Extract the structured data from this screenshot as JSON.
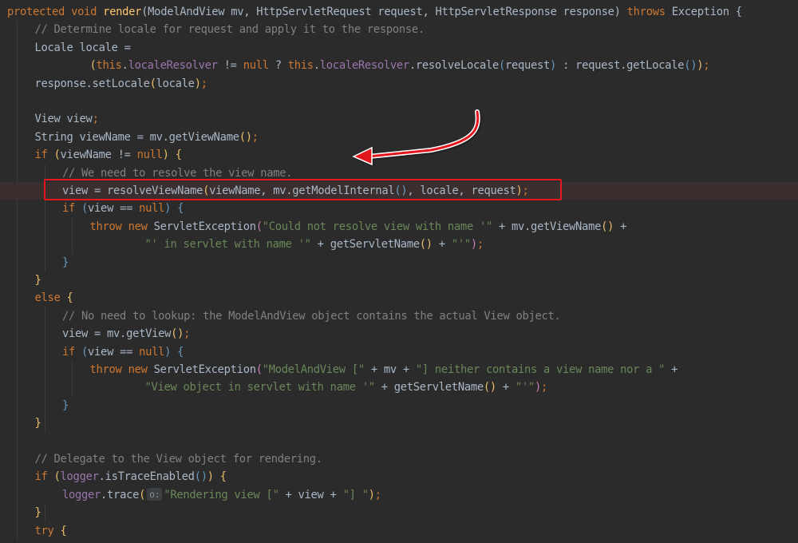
{
  "editor": {
    "language": "java",
    "colors": {
      "background": "#2b2b2b",
      "keyword": "#cc7832",
      "method": "#ffc66d",
      "string": "#6a8759",
      "comment": "#808080",
      "field": "#9876aa",
      "text": "#a9b7c6",
      "annotation_box": "#e3191f",
      "annotation_arrow": "#e3191f"
    },
    "annotation": {
      "type": "red box with curved arrow",
      "highlighted_line_index": 10
    },
    "lines": [
      {
        "indent": 0,
        "tokens": [
          {
            "t": "protected",
            "c": "kw"
          },
          {
            "t": " "
          },
          {
            "t": "void",
            "c": "kw"
          },
          {
            "t": " "
          },
          {
            "t": "render",
            "c": "fn"
          },
          {
            "t": "(ModelAndView mv, HttpServletRequest request, HttpServletResponse response) "
          },
          {
            "t": "throws",
            "c": "kw"
          },
          {
            "t": " Exception {"
          }
        ]
      },
      {
        "indent": 1,
        "tokens": [
          {
            "t": "// Determine locale for request and apply it to the response.",
            "c": "cm"
          }
        ]
      },
      {
        "indent": 1,
        "tokens": [
          {
            "t": "Locale locale ="
          }
        ]
      },
      {
        "indent": 3,
        "tokens": [
          {
            "t": "(",
            "c": "p1"
          },
          {
            "t": "this",
            "c": "kw"
          },
          {
            "t": "."
          },
          {
            "t": "localeResolver",
            "c": "fld"
          },
          {
            "t": " != "
          },
          {
            "t": "null",
            "c": "kw"
          },
          {
            "t": " ? "
          },
          {
            "t": "this",
            "c": "kw"
          },
          {
            "t": "."
          },
          {
            "t": "localeResolver",
            "c": "fld"
          },
          {
            "t": ".resolveLocale"
          },
          {
            "t": "(",
            "c": "p2"
          },
          {
            "t": "request"
          },
          {
            "t": ")",
            "c": "p2"
          },
          {
            "t": " : request.getLocale"
          },
          {
            "t": "()",
            "c": "p2"
          },
          {
            "t": ")",
            "c": "p1"
          },
          {
            "t": ";",
            "c": "kw"
          }
        ]
      },
      {
        "indent": 1,
        "tokens": [
          {
            "t": "response.setLocale"
          },
          {
            "t": "(",
            "c": "p1"
          },
          {
            "t": "locale"
          },
          {
            "t": ")",
            "c": "p1"
          },
          {
            "t": ";",
            "c": "kw"
          }
        ]
      },
      {
        "indent": 0,
        "tokens": []
      },
      {
        "indent": 1,
        "tokens": [
          {
            "t": "View view"
          },
          {
            "t": ";",
            "c": "kw"
          }
        ]
      },
      {
        "indent": 1,
        "tokens": [
          {
            "t": "String viewName = mv.getViewName"
          },
          {
            "t": "()",
            "c": "p1"
          },
          {
            "t": ";",
            "c": "kw"
          }
        ]
      },
      {
        "indent": 1,
        "tokens": [
          {
            "t": "if",
            "c": "kw"
          },
          {
            "t": " "
          },
          {
            "t": "(",
            "c": "p1"
          },
          {
            "t": "viewName != "
          },
          {
            "t": "null",
            "c": "kw"
          },
          {
            "t": ")",
            "c": "p1"
          },
          {
            "t": " "
          },
          {
            "t": "{",
            "c": "p1"
          }
        ]
      },
      {
        "indent": 2,
        "tokens": [
          {
            "t": "// We need to resolve the view name.",
            "c": "cm"
          }
        ]
      },
      {
        "indent": 2,
        "tokens": [
          {
            "t": "view = resolveViewName"
          },
          {
            "t": "(",
            "c": "p1"
          },
          {
            "t": "viewName, mv.getModelInternal"
          },
          {
            "t": "()",
            "c": "p2"
          },
          {
            "t": ", locale, request"
          },
          {
            "t": ")",
            "c": "p1"
          },
          {
            "t": ";",
            "c": "kw"
          }
        ]
      },
      {
        "indent": 2,
        "tokens": [
          {
            "t": "if",
            "c": "kw"
          },
          {
            "t": " "
          },
          {
            "t": "(",
            "c": "p2"
          },
          {
            "t": "view == "
          },
          {
            "t": "null",
            "c": "kw"
          },
          {
            "t": ")",
            "c": "p2"
          },
          {
            "t": " "
          },
          {
            "t": "{",
            "c": "p2"
          }
        ]
      },
      {
        "indent": 3,
        "tokens": [
          {
            "t": "throw",
            "c": "kw"
          },
          {
            "t": " "
          },
          {
            "t": "new",
            "c": "kw"
          },
          {
            "t": " ServletException"
          },
          {
            "t": "(",
            "c": "p3"
          },
          {
            "t": "\"Could not resolve view with name '\"",
            "c": "str"
          },
          {
            "t": " + mv.getViewName"
          },
          {
            "t": "()",
            "c": "p1"
          },
          {
            "t": " +"
          }
        ]
      },
      {
        "indent": 5,
        "tokens": [
          {
            "t": "\"' in servlet with name '\"",
            "c": "str"
          },
          {
            "t": " + getServletName"
          },
          {
            "t": "()",
            "c": "p1"
          },
          {
            "t": " + "
          },
          {
            "t": "\"'\"",
            "c": "str"
          },
          {
            "t": ")",
            "c": "p3"
          },
          {
            "t": ";",
            "c": "kw"
          }
        ]
      },
      {
        "indent": 2,
        "tokens": [
          {
            "t": "}",
            "c": "p2"
          }
        ]
      },
      {
        "indent": 1,
        "tokens": [
          {
            "t": "}",
            "c": "p1"
          }
        ]
      },
      {
        "indent": 1,
        "tokens": [
          {
            "t": "else",
            "c": "kw"
          },
          {
            "t": " "
          },
          {
            "t": "{",
            "c": "p1"
          }
        ]
      },
      {
        "indent": 2,
        "tokens": [
          {
            "t": "// No need to lookup: the ModelAndView object contains the actual View object.",
            "c": "cm"
          }
        ]
      },
      {
        "indent": 2,
        "tokens": [
          {
            "t": "view = mv.getView"
          },
          {
            "t": "()",
            "c": "p1"
          },
          {
            "t": ";",
            "c": "kw"
          }
        ]
      },
      {
        "indent": 2,
        "tokens": [
          {
            "t": "if",
            "c": "kw"
          },
          {
            "t": " "
          },
          {
            "t": "(",
            "c": "p2"
          },
          {
            "t": "view == "
          },
          {
            "t": "null",
            "c": "kw"
          },
          {
            "t": ")",
            "c": "p2"
          },
          {
            "t": " "
          },
          {
            "t": "{",
            "c": "p2"
          }
        ]
      },
      {
        "indent": 3,
        "tokens": [
          {
            "t": "throw",
            "c": "kw"
          },
          {
            "t": " "
          },
          {
            "t": "new",
            "c": "kw"
          },
          {
            "t": " ServletException"
          },
          {
            "t": "(",
            "c": "p3"
          },
          {
            "t": "\"ModelAndView [\"",
            "c": "str"
          },
          {
            "t": " + mv + "
          },
          {
            "t": "\"] neither contains a view name nor a \"",
            "c": "str"
          },
          {
            "t": " +"
          }
        ]
      },
      {
        "indent": 5,
        "tokens": [
          {
            "t": "\"View object in servlet with name '\"",
            "c": "str"
          },
          {
            "t": " + getServletName"
          },
          {
            "t": "()",
            "c": "p1"
          },
          {
            "t": " + "
          },
          {
            "t": "\"'\"",
            "c": "str"
          },
          {
            "t": ")",
            "c": "p3"
          },
          {
            "t": ";",
            "c": "kw"
          }
        ]
      },
      {
        "indent": 2,
        "tokens": [
          {
            "t": "}",
            "c": "p2"
          }
        ]
      },
      {
        "indent": 1,
        "tokens": [
          {
            "t": "}",
            "c": "p1"
          }
        ]
      },
      {
        "indent": 0,
        "tokens": []
      },
      {
        "indent": 1,
        "tokens": [
          {
            "t": "// Delegate to the View object for rendering.",
            "c": "cm"
          }
        ]
      },
      {
        "indent": 1,
        "tokens": [
          {
            "t": "if",
            "c": "kw"
          },
          {
            "t": " "
          },
          {
            "t": "(",
            "c": "p1"
          },
          {
            "t": "logger",
            "c": "fld"
          },
          {
            "t": ".isTraceEnabled"
          },
          {
            "t": "()",
            "c": "p2"
          },
          {
            "t": ")",
            "c": "p1"
          },
          {
            "t": " "
          },
          {
            "t": "{",
            "c": "p1"
          }
        ]
      },
      {
        "indent": 2,
        "tokens": [
          {
            "t": "logger",
            "c": "fld"
          },
          {
            "t": ".trace"
          },
          {
            "t": "(",
            "c": "p1"
          },
          {
            "t": "o:",
            "c": "hint"
          },
          {
            "t": "\"Rendering view [\"",
            "c": "str"
          },
          {
            "t": " + view + "
          },
          {
            "t": "\"] \"",
            "c": "str"
          },
          {
            "t": ")",
            "c": "p1"
          },
          {
            "t": ";",
            "c": "kw"
          }
        ]
      },
      {
        "indent": 1,
        "tokens": [
          {
            "t": "}",
            "c": "p1"
          }
        ]
      },
      {
        "indent": 1,
        "tokens": [
          {
            "t": "try",
            "c": "kw"
          },
          {
            "t": " "
          },
          {
            "t": "{",
            "c": "p1"
          }
        ]
      }
    ]
  }
}
